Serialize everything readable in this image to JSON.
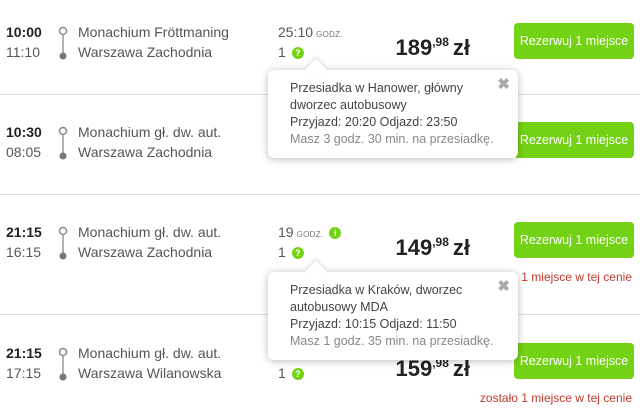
{
  "connections": [
    {
      "departure": "10:00",
      "arrival": "11:10",
      "from": "Monachium Fröttmaning",
      "to": "Warszawa Zachodnia",
      "duration": "25:10",
      "duration_unit": "GODZ.",
      "changes": "1",
      "price_main": "189",
      "price_cents": ",98",
      "currency": "zł",
      "button": "Rezerwuj 1 miejsce",
      "seats_note": ""
    },
    {
      "departure": "10:30",
      "arrival": "08:05",
      "from": "Monachium gł. dw. aut.",
      "to": "Warszawa Zachodnia",
      "duration": "",
      "duration_unit": "",
      "changes": "",
      "price_main": "",
      "price_cents": "",
      "currency": "",
      "button": "Rezerwuj 1 miejsce",
      "seats_note": ""
    },
    {
      "departure": "21:15",
      "arrival": "16:15",
      "from": "Monachium gł. dw. aut.",
      "to": "Warszawa Zachodnia",
      "duration": "19",
      "duration_unit": "GODZ.",
      "changes": "1",
      "price_main": "149",
      "price_cents": ",98",
      "currency": "zł",
      "button": "Rezerwuj 1 miejsce",
      "seats_note": "1 miejsce w tej cenie"
    },
    {
      "departure": "21:15",
      "arrival": "17:15",
      "from": "Monachium gł. dw. aut.",
      "to": "Warszawa Wilanowska",
      "duration": "",
      "duration_unit": "",
      "changes": "1",
      "price_main": "159",
      "price_cents": ",98",
      "currency": "zł",
      "button": "Rezerwuj 1 miejsce",
      "seats_note": "zostało 1 miejsce w tej cenie"
    }
  ],
  "tooltips": [
    {
      "line1": "Przesiadka w Hanower, główny",
      "line2": "dworzec autobusowy",
      "times": "Przyjazd: 20:20 Odjazd: 23:50",
      "wait": "Masz 3 godz. 30 min. na przesiadkę.",
      "close": "✖"
    },
    {
      "line1": "Przesiadka w Kraków, dworzec",
      "line2": "autobusowy MDA",
      "times": "Przyjazd: 10:15 Odjazd: 11:50",
      "wait": "Masz 1 godz. 35 min. na przesiadkę.",
      "close": "✖"
    }
  ],
  "icons": {
    "question": "?",
    "info": "i"
  },
  "colors": {
    "accent_green": "#73d216",
    "warning_red": "#c0392b"
  }
}
